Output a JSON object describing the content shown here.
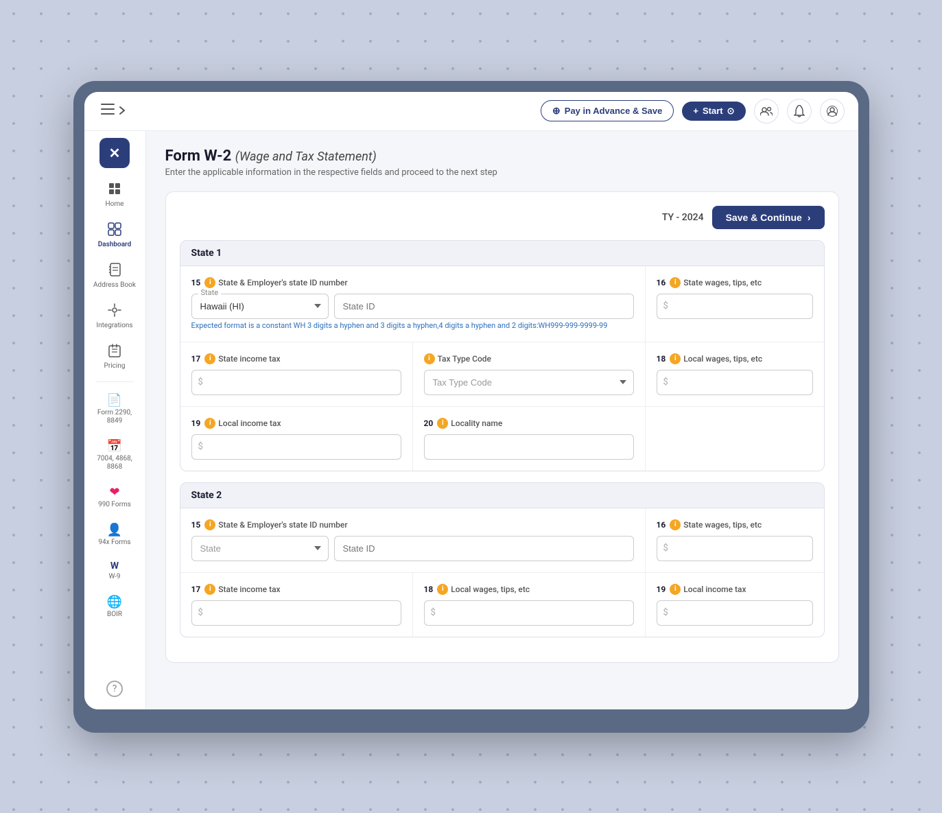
{
  "header": {
    "menu_icon": "≡",
    "pay_advance_label": "Pay in Advance & Save",
    "start_label": "Start",
    "plus_icon": "+",
    "circle_arrow_icon": "⊕"
  },
  "sidebar": {
    "logo": "✕",
    "items": [
      {
        "id": "home",
        "label": "Home",
        "icon": "⊞"
      },
      {
        "id": "dashboard",
        "label": "Dashboard",
        "icon": "📋"
      },
      {
        "id": "address-book",
        "label": "Address Book",
        "icon": "📖"
      },
      {
        "id": "integrations",
        "label": "Integrations",
        "icon": "⚙"
      },
      {
        "id": "pricing",
        "label": "Pricing",
        "icon": "🏷"
      },
      {
        "id": "form2290",
        "label": "Form 2290, 8849",
        "icon": "📄"
      },
      {
        "id": "form7004",
        "label": "7004, 4868, 8868",
        "icon": "📅"
      },
      {
        "id": "form990",
        "label": "990 Forms",
        "icon": "❤"
      },
      {
        "id": "form94x",
        "label": "94x Forms",
        "icon": "👤"
      },
      {
        "id": "formw9",
        "label": "W-9",
        "icon": "W"
      },
      {
        "id": "boir",
        "label": "BOIR",
        "icon": "🌐"
      },
      {
        "id": "help",
        "label": "",
        "icon": "?"
      }
    ]
  },
  "page": {
    "form_title": "Form W-2",
    "form_subtitle": "(Wage and Tax Statement)",
    "description": "Enter the applicable information in the respective fields and proceed to the next step",
    "tax_year": "TY - 2024",
    "save_continue_label": "Save & Continue",
    "chevron_icon": "›"
  },
  "state1": {
    "header": "State 1",
    "field15_num": "15",
    "field15_label": "State & Employer's state ID number",
    "state_label": "State",
    "state_value": "Hawaii (HI)",
    "state_id_placeholder": "State ID",
    "format_hint": "Expected format is a constant WH 3 digits a hyphen and 3 digits a hyphen,4 digits a hyphen and 2 digits:WH999-999-9999-99",
    "field16_num": "16",
    "field16_label": "State wages, tips, etc",
    "field17_num": "17",
    "field17_label": "State income tax",
    "tax_type_num": "",
    "tax_type_label": "Tax Type Code",
    "tax_type_placeholder": "Tax Type Code",
    "field18_num": "18",
    "field18_label": "Local wages, tips, etc",
    "field19_num": "19",
    "field19_label": "Local income tax",
    "field20_num": "20",
    "field20_label": "Locality name"
  },
  "state2": {
    "header": "State 2",
    "field15_num": "15",
    "field15_label": "State & Employer's state ID number",
    "state_placeholder": "State",
    "state_id_placeholder": "State ID",
    "field16_num": "16",
    "field16_label": "State wages, tips, etc",
    "field17_num": "17",
    "field17_label": "State income tax",
    "field18_num": "18",
    "field18_label": "Local wages, tips, etc",
    "field19_num": "19",
    "field19_label": "Local income tax"
  }
}
